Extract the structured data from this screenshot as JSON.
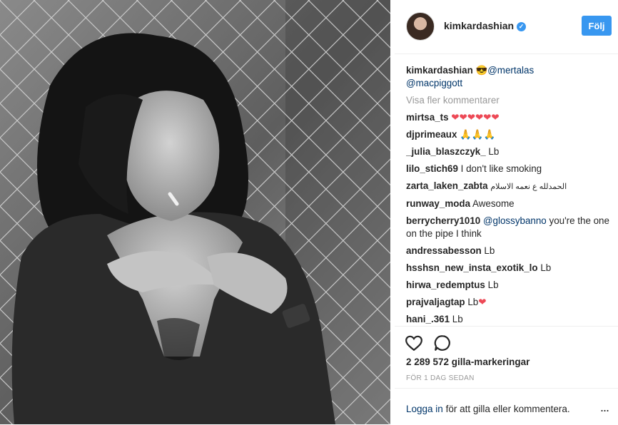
{
  "post": {
    "username": "kimkardashian",
    "follow_label": "Följ",
    "caption_user": "kimkardashian",
    "caption_emoji": "😎",
    "caption_mentions": [
      "@mertalas",
      "@macpiggott"
    ],
    "more_comments": "Visa fler kommentarer",
    "comments": [
      {
        "user": "mirtsa_ts",
        "text": "❤❤❤❤❤❤",
        "type": "hearts"
      },
      {
        "user": "djprimeaux",
        "text": "🙏🙏🙏",
        "type": "emoji"
      },
      {
        "user": "_julia_blaszczyk_",
        "text": "Lb",
        "type": "text"
      },
      {
        "user": "lilo_stich69",
        "text": "I don't like smoking",
        "type": "text"
      },
      {
        "user": "zarta_laken_zabta",
        "text": "الحمدلله ع نعمه الاسلام",
        "type": "text"
      },
      {
        "user": "runway_moda",
        "text": "Awesome",
        "type": "text"
      },
      {
        "user": "berrycherry1010",
        "mention": "@glossybanno",
        "text": "you're the one on the pipe I think",
        "type": "mention"
      },
      {
        "user": "andressabesson",
        "text": "Lb",
        "type": "text"
      },
      {
        "user": "hsshsn_new_insta_exotik_lo",
        "text": "Lb",
        "type": "text"
      },
      {
        "user": "hirwa_redemptus",
        "text": "Lb",
        "type": "text"
      },
      {
        "user": "prajvaljagtap",
        "text": "Lb",
        "suffix": "❤",
        "type": "suffix"
      },
      {
        "user": "hani_.361",
        "text": "Lb",
        "type": "text"
      }
    ],
    "likes": "2 289 572 gilla-markeringar",
    "time": "FÖR 1 DAG SEDAN",
    "login_link": "Logga in",
    "login_rest": " för att gilla eller kommentera.",
    "more_options": "..."
  },
  "icons": {
    "like": "heart-outline-icon",
    "comment": "speech-bubble-icon",
    "verified": "verified-badge-icon"
  },
  "colors": {
    "accent": "#3897f0",
    "link": "#003569",
    "muted": "#999999",
    "heart": "#ed4956"
  }
}
